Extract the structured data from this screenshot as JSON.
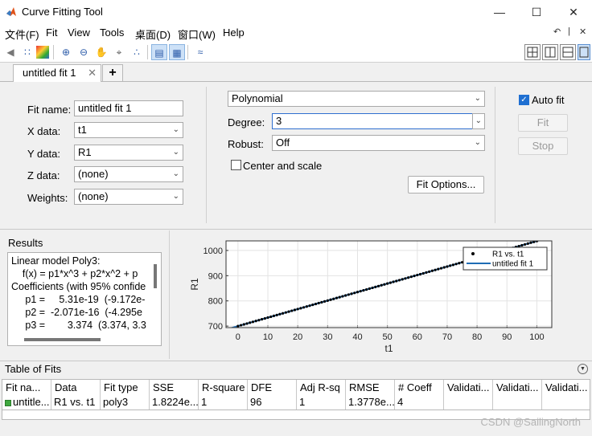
{
  "window": {
    "title": "Curve Fitting Tool"
  },
  "menu": [
    "文件(F)",
    "Fit",
    "View",
    "Tools",
    "桌面(D)",
    "窗口(W)",
    "Help"
  ],
  "tabs": [
    {
      "label": "untitled fit 1"
    }
  ],
  "fit_panel": {
    "fit_name_label": "Fit name:",
    "fit_name_value": "untitled fit 1",
    "x_label": "X data:",
    "x_value": "t1",
    "y_label": "Y data:",
    "y_value": "R1",
    "z_label": "Z data:",
    "z_value": "(none)",
    "w_label": "Weights:",
    "w_value": "(none)",
    "model_type": "Polynomial",
    "degree_label": "Degree:",
    "degree_value": "3",
    "robust_label": "Robust:",
    "robust_value": "Off",
    "center_scale_label": "Center and scale",
    "fit_options_label": "Fit Options...",
    "auto_fit_label": "Auto fit",
    "fit_button": "Fit",
    "stop_button": "Stop"
  },
  "results": {
    "title": "Results",
    "lines": [
      "Linear model Poly3:",
      "    f(x) = p1*x^3 + p2*x^2 + p",
      "Coefficients (with 95% confide",
      "     p1 =     5.31e-19  (-9.172e-",
      "     p2 =  -2.071e-16  (-4.295e",
      "     p3 =        3.374  (3.374, 3.3"
    ]
  },
  "chart_data": {
    "type": "scatter",
    "xlabel": "t1",
    "ylabel": "R1",
    "xlim": [
      -4,
      105
    ],
    "ylim": [
      694,
      1038
    ],
    "xticks": [
      0,
      10,
      20,
      30,
      40,
      50,
      60,
      70,
      80,
      90,
      100
    ],
    "yticks": [
      700,
      800,
      900,
      1000
    ],
    "grid": true,
    "legend": "top-right",
    "series": [
      {
        "name": "R1 vs. t1",
        "kind": "points",
        "color": "#000000",
        "x": [
          0,
          1,
          2,
          3,
          4,
          5,
          6,
          7,
          8,
          9,
          10,
          11,
          12,
          13,
          14,
          15,
          16,
          17,
          18,
          19,
          20,
          21,
          22,
          23,
          24,
          25,
          26,
          27,
          28,
          29,
          30,
          31,
          32,
          33,
          34,
          35,
          36,
          37,
          38,
          39,
          40,
          41,
          42,
          43,
          44,
          45,
          46,
          47,
          48,
          49,
          50,
          51,
          52,
          53,
          54,
          55,
          56,
          57,
          58,
          59,
          60,
          61,
          62,
          63,
          64,
          65,
          66,
          67,
          68,
          69,
          70,
          71,
          72,
          73,
          74,
          75,
          76,
          77,
          78,
          79,
          80,
          81,
          82,
          83,
          84,
          85,
          86,
          87,
          88,
          89,
          90,
          91,
          92,
          93,
          94,
          95,
          96,
          97,
          98,
          99,
          100
        ],
        "y": [
          700,
          703.374,
          706.748,
          710.122,
          713.496,
          716.87,
          720.244,
          723.618,
          726.992,
          730.366,
          733.74,
          737.114,
          740.488,
          743.862,
          747.236,
          750.61,
          753.984,
          757.358,
          760.732,
          764.106,
          767.48,
          770.854,
          774.228,
          777.602,
          780.976,
          784.35,
          787.724,
          791.098,
          794.472,
          797.846,
          801.22,
          804.594,
          807.968,
          811.342,
          814.716,
          818.09,
          821.464,
          824.838,
          828.212,
          831.586,
          834.96,
          838.334,
          841.708,
          845.082,
          848.456,
          851.83,
          855.204,
          858.578,
          861.952,
          865.326,
          868.7,
          872.074,
          875.448,
          878.822,
          882.196,
          885.57,
          888.944,
          892.318,
          895.692,
          899.066,
          902.44,
          905.814,
          909.188,
          912.562,
          915.936,
          919.31,
          922.684,
          926.058,
          929.432,
          932.806,
          936.18,
          939.554,
          942.928,
          946.302,
          949.676,
          953.05,
          956.424,
          959.798,
          963.172,
          966.546,
          969.92,
          973.294,
          976.668,
          980.042,
          983.416,
          986.79,
          990.164,
          993.538,
          996.912,
          1000.286,
          1003.66,
          1007.034,
          1010.408,
          1013.782,
          1017.156,
          1020.53,
          1023.904,
          1027.278,
          1030.652,
          1034.026,
          1037.4
        ]
      },
      {
        "name": "untitled fit 1",
        "kind": "line",
        "color": "#1f6db5",
        "x": [
          -4,
          105
        ],
        "y": [
          686.5,
          1054.3
        ]
      }
    ]
  },
  "table": {
    "title": "Table of Fits",
    "columns": [
      "Fit na...",
      "Data",
      "Fit type",
      "SSE",
      "R-square",
      "DFE",
      "Adj R-sq",
      "RMSE",
      "# Coeff",
      "Validati...",
      "Validati...",
      "Validati..."
    ],
    "rows": [
      [
        "untitle...",
        "R1 vs. t1",
        "poly3",
        "1.8224e...",
        "1",
        "96",
        "1",
        "1.3778e...",
        "4",
        "",
        "",
        ""
      ]
    ]
  },
  "watermark": "CSDN @SailingNorth",
  "colors": {
    "accent": "#1f6fd1",
    "fit_line": "#1f6db5",
    "window_bg": "#f0f0f0"
  }
}
